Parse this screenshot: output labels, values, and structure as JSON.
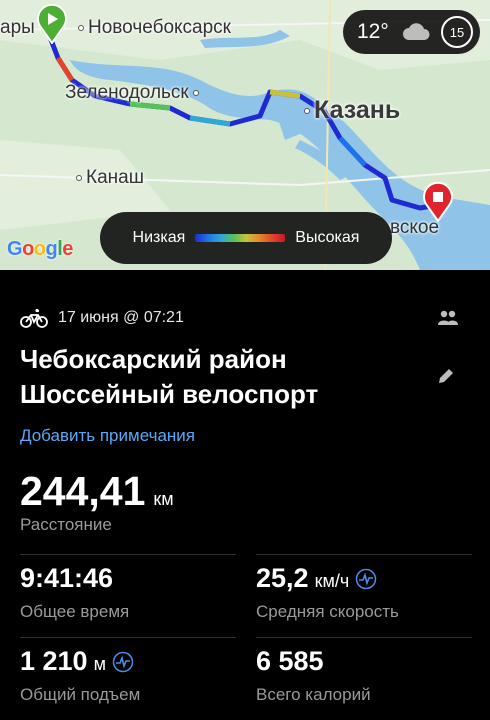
{
  "map": {
    "labels": {
      "cheboksary_partial": "ары",
      "novocheboksarsk": "Новочебоксарск",
      "zelenodolsk": "Зеленодольск",
      "kazan": "Казань",
      "kanash": "Канаш",
      "end_partial": "вское"
    },
    "weather": {
      "temperature": "12°",
      "icon": "cloud-icon",
      "badge": "15"
    },
    "legend": {
      "low": "Низкая",
      "high": "Высокая"
    },
    "attribution": "Google"
  },
  "activity": {
    "icon": "bicycle-icon",
    "datetime": "17 июня @ 07:21",
    "title_line1": "Чебоксарский район",
    "title_line2": "Шоссейный велоспорт",
    "add_note": "Добавить примечания"
  },
  "distance": {
    "value": "244,41",
    "unit": "км",
    "label": "Расстояние"
  },
  "stats": {
    "total_time": {
      "value": "9:41:46",
      "unit": "",
      "label": "Общее время"
    },
    "avg_speed": {
      "value": "25,2",
      "unit": "км/ч",
      "label": "Средняя скорость"
    },
    "elevation": {
      "value": "1 210",
      "unit": "м",
      "label": "Общий подъем"
    },
    "calories": {
      "value": "6 585",
      "unit": "",
      "label": "Всего калорий"
    }
  },
  "colors": {
    "accent": "#5aa8f5",
    "route_low": "#1e2ad6",
    "route_high": "#c5192a",
    "start_pin": "#4caf32",
    "end_pin": "#e0242b"
  }
}
